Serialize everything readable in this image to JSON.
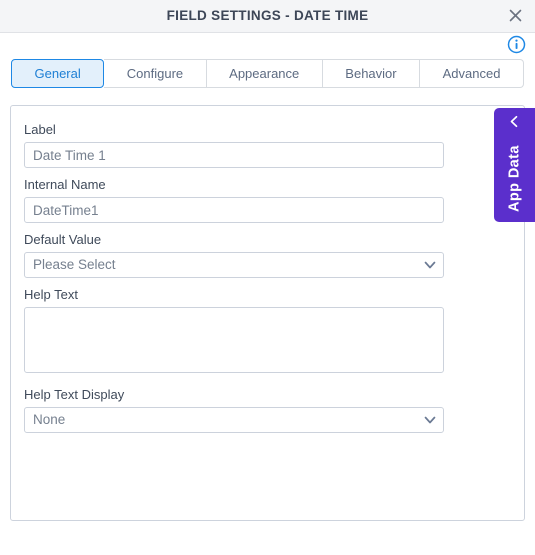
{
  "window": {
    "title": "FIELD SETTINGS - DATE TIME",
    "close_icon": "close-icon",
    "info_icon": "info-icon",
    "accent_blue": "#1e88e5",
    "accent_purple": "#5b2fcc"
  },
  "tabs": [
    {
      "label": "General",
      "active": true
    },
    {
      "label": "Configure",
      "active": false
    },
    {
      "label": "Appearance",
      "active": false
    },
    {
      "label": "Behavior",
      "active": false
    },
    {
      "label": "Advanced",
      "active": false
    }
  ],
  "form": {
    "label_field": {
      "label": "Label",
      "value": "Date Time 1",
      "placeholder": "Date Time 1"
    },
    "internal_name_field": {
      "label": "Internal Name",
      "value": "DateTime1",
      "placeholder": "DateTime1"
    },
    "default_value_field": {
      "label": "Default Value",
      "value": "Please Select",
      "options": [
        "Please Select"
      ]
    },
    "help_text_field": {
      "label": "Help Text",
      "value": "",
      "placeholder": ""
    },
    "help_text_display_field": {
      "label": "Help Text Display",
      "value": "None",
      "options": [
        "None"
      ]
    }
  },
  "side_panel": {
    "label": "App Data",
    "chevron_icon": "chevron-left-icon"
  }
}
